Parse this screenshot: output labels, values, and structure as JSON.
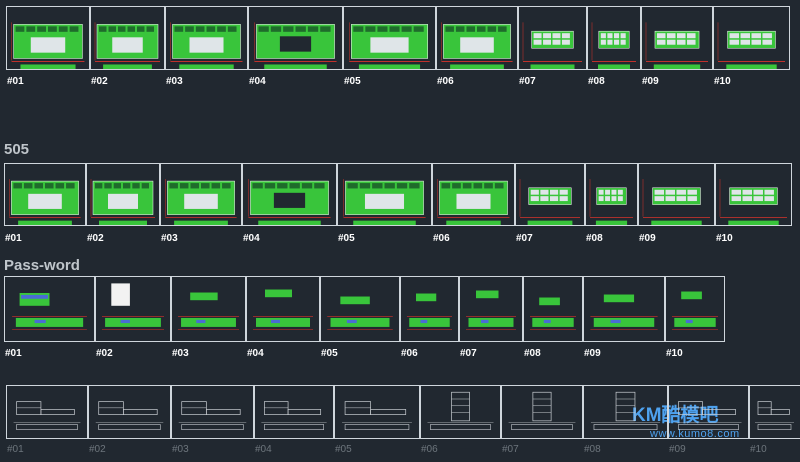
{
  "colors": {
    "background": "#212830",
    "frame": "#cfd6dc",
    "green": "#39c53b",
    "panel_light": "#dfe5e8",
    "red_dimension": "#d7322b",
    "label": "#ffffff",
    "watermark": "#4ea2ef"
  },
  "sections": [
    {
      "title": "",
      "labels": [
        "#01",
        "#02",
        "#03",
        "#04",
        "#05",
        "#06",
        "#07",
        "#08",
        "#09",
        "#10"
      ]
    },
    {
      "title": "505",
      "labels": [
        "#01",
        "#02",
        "#03",
        "#04",
        "#05",
        "#06",
        "#07",
        "#08",
        "#09",
        "#10"
      ]
    },
    {
      "title": "Pass-word",
      "labels": [
        "#01",
        "#02",
        "#03",
        "#04",
        "#05",
        "#06",
        "#07",
        "#08",
        "#09",
        "#10"
      ]
    },
    {
      "title": "",
      "labels": [
        "#01",
        "#02",
        "#03",
        "#04",
        "#05",
        "#06",
        "#07",
        "#08",
        "#09",
        "#10"
      ]
    }
  ],
  "watermark": {
    "logo": "KM酷模吧",
    "url": "www.kumo8.com"
  }
}
